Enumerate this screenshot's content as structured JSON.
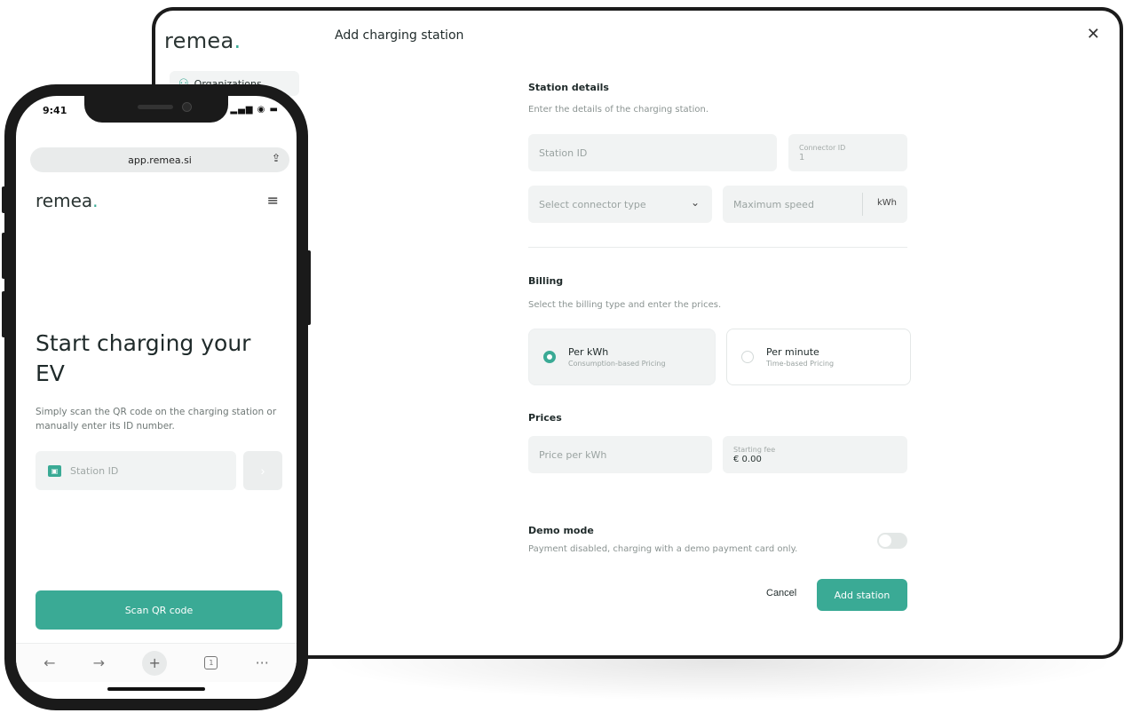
{
  "tablet": {
    "brand": {
      "name": "remea",
      "dot": "."
    },
    "sidebar": {
      "items": [
        {
          "label": "Organizations",
          "icon": "organization-icon"
        }
      ]
    },
    "modal": {
      "title": "Add charging station",
      "close_icon": "✕",
      "station_details": {
        "title": "Station details",
        "description": "Enter the details of the charging station.",
        "station_id_placeholder": "Station ID",
        "connector_id_label": "Connector ID",
        "connector_id_value": "1",
        "connector_type_placeholder": "Select connector type",
        "max_speed_placeholder": "Maximum speed",
        "max_speed_unit": "kWh"
      },
      "billing": {
        "title": "Billing",
        "description": "Select the billing type and enter the prices.",
        "options": [
          {
            "label": "Per kWh",
            "sublabel": "Consumption-based Pricing",
            "selected": true
          },
          {
            "label": "Per minute",
            "sublabel": "Time-based Pricing",
            "selected": false
          }
        ]
      },
      "prices": {
        "title": "Prices",
        "price_per_kwh_placeholder": "Price per kWh",
        "starting_fee_label": "Starting fee",
        "starting_fee_value": "€ 0.00"
      },
      "demo_mode": {
        "title": "Demo mode",
        "description": "Payment disabled, charging with a demo payment card only.",
        "enabled": false
      },
      "actions": {
        "cancel": "Cancel",
        "submit": "Add station"
      }
    }
  },
  "phone": {
    "status": {
      "time": "9:41",
      "icons": "▂▄▆ ◉ ▬"
    },
    "browser": {
      "url": "app.remea.si",
      "share_icon": "⇪"
    },
    "brand": {
      "name": "remea",
      "dot": "."
    },
    "menu_icon": "≡",
    "hero_title": "Start charging your EV",
    "hero_desc": "Simply scan the QR code on the charging station or manually enter its ID number.",
    "station_input_placeholder": "Station ID",
    "go_icon": "›",
    "scan_button": "Scan QR code",
    "toolbar": {
      "back": "←",
      "forward": "→",
      "new_tab": "+",
      "tabs_count": "1",
      "more": "···"
    }
  },
  "colors": {
    "accent": "#3aaa95",
    "field_bg": "#f1f3f3",
    "device_frame": "#1b1b1b"
  }
}
